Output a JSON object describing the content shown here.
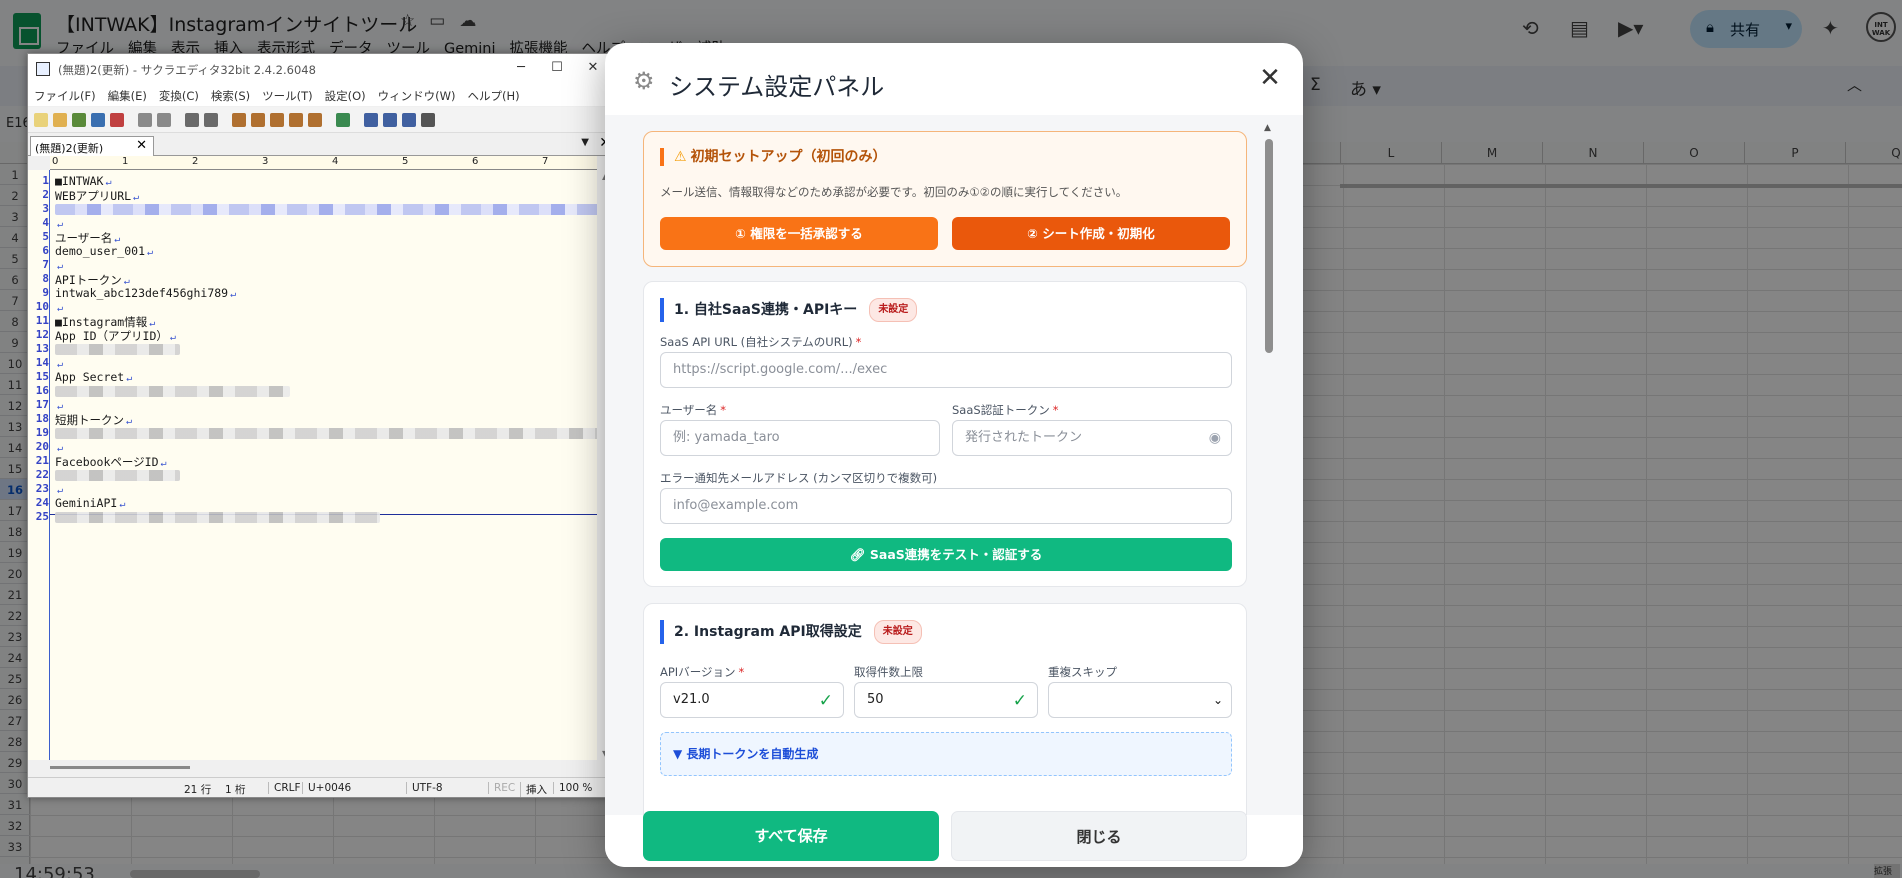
{
  "sheets": {
    "doc_title": "【INTWAK】Instagramインサイトツール",
    "menu": [
      "ファイル",
      "編集",
      "表示",
      "挿入",
      "表示形式",
      "データ",
      "ツール",
      "Gemini",
      "拡張機能",
      "ヘルプ",
      "ユーザー補助"
    ],
    "share_label": "共有",
    "avatar_text": "INT WAK",
    "toolbar_sigma": "Σ",
    "toolbar_ime": "あ ▾",
    "namebox": "E16",
    "columns": [
      "L",
      "M",
      "N",
      "O",
      "P",
      "Q"
    ],
    "rows": [
      "1",
      "2",
      "3",
      "4",
      "5",
      "6",
      "7",
      "8",
      "9",
      "10",
      "11",
      "12",
      "13",
      "14",
      "15",
      "16",
      "17",
      "18",
      "19",
      "20",
      "21",
      "22",
      "23",
      "24",
      "25",
      "26",
      "27",
      "28",
      "29",
      "30",
      "31",
      "32",
      "33"
    ],
    "selected_row": "16",
    "clock": "14:59:53",
    "corner_text": "拡張"
  },
  "editor": {
    "window_title": "(無題)2(更新) - サクラエディタ32bit 2.4.2.6048",
    "menu": [
      "ファイル(F)",
      "編集(E)",
      "変換(C)",
      "検索(S)",
      "ツール(T)",
      "設定(O)",
      "ウィンドウ(W)",
      "ヘルプ(H)"
    ],
    "tab_label": "(無題)2(更新)",
    "ruler_marks": [
      "0",
      "1",
      "2",
      "3",
      "4",
      "5",
      "6",
      "7"
    ],
    "lines": [
      {
        "n": "1",
        "text": "■INTWAK"
      },
      {
        "n": "2",
        "text": "WEBアプリURL"
      },
      {
        "n": "3",
        "text": ""
      },
      {
        "n": "4",
        "text": ""
      },
      {
        "n": "5",
        "text": "ユーザー名"
      },
      {
        "n": "6",
        "text": "demo_user_001"
      },
      {
        "n": "7",
        "text": ""
      },
      {
        "n": "8",
        "text": "APIトークン"
      },
      {
        "n": "9",
        "text": "intwak_abc123def456ghi789"
      },
      {
        "n": "10",
        "text": ""
      },
      {
        "n": "11",
        "text": "■Instagram情報"
      },
      {
        "n": "12",
        "text": "App ID（アプリID）"
      },
      {
        "n": "13",
        "text": ""
      },
      {
        "n": "14",
        "text": ""
      },
      {
        "n": "15",
        "text": "App Secret"
      },
      {
        "n": "16",
        "text": ""
      },
      {
        "n": "17",
        "text": ""
      },
      {
        "n": "18",
        "text": "短期トークン"
      },
      {
        "n": "19",
        "text": ""
      },
      {
        "n": "20",
        "text": ""
      },
      {
        "n": "21",
        "text": "FacebookページID"
      },
      {
        "n": "22",
        "text": ""
      },
      {
        "n": "23",
        "text": ""
      },
      {
        "n": "24",
        "text": "GeminiAPI"
      },
      {
        "n": "25",
        "text": ""
      }
    ],
    "status": {
      "position": "21 行　 1 桁",
      "eol": "CRLF",
      "code": "U+0046",
      "encoding": "UTF-8",
      "rec": "REC",
      "mode": "挿入",
      "zoom": "100 %"
    }
  },
  "modal": {
    "title": "システム設定パネル",
    "setup": {
      "title": "初期セットアップ（初回のみ）",
      "description": "メール送信、情報取得などのため承認が必要です。初回のみ①②の順に実行してください。",
      "btn_authorize": "① 権限を一括承認する",
      "btn_init": "② シート作成・初期化"
    },
    "section1": {
      "title": "1. 自社SaaS連携・APIキー",
      "badge": "未設定",
      "api_url_label": "SaaS API URL (自社システムのURL)",
      "api_url_placeholder": "https://script.google.com/.../exec",
      "username_label": "ユーザー名",
      "username_placeholder": "例: yamada_taro",
      "token_label": "SaaS認証トークン",
      "token_placeholder": "発行されたトークン",
      "email_label": "エラー通知先メールアドレス (カンマ区切りで複数可)",
      "email_placeholder": "info@example.com",
      "test_button": "SaaS連携をテスト・認証する",
      "required_mark": "*"
    },
    "section2": {
      "title": "2. Instagram API取得設定",
      "badge": "未設定",
      "api_version_label": "APIバージョン",
      "api_version_value": "v21.0",
      "limit_label": "取得件数上限",
      "limit_value": "50",
      "skip_label": "重複スキップ",
      "skip_value": "",
      "collapse_label": "▼ 長期トークンを自動生成",
      "required_mark": "*"
    },
    "footer": {
      "save": "すべて保存",
      "close": "閉じる"
    }
  }
}
